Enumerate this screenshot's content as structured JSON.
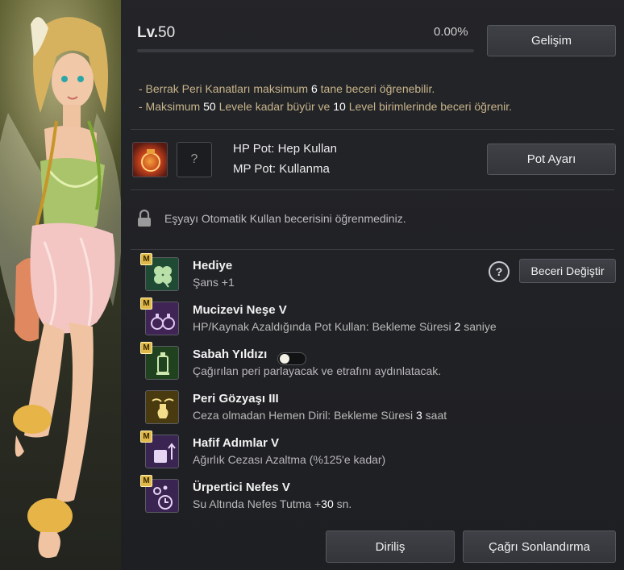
{
  "level": {
    "prefix": "Lv.",
    "value": "50",
    "percent": "0.00%",
    "progress": 0
  },
  "buttons": {
    "upgrade": "Gelişim",
    "pot_settings": "Pot Ayarı",
    "change_skill": "Beceri Değiştir",
    "revive": "Diriliş",
    "end_summon": "Çağrı Sonlandırma"
  },
  "info": {
    "line1_a": "- Berrak Peri Kanatları maksimum ",
    "line1_n": "6",
    "line1_b": " tane beceri öğrenebilir.",
    "line2_a": "- Maksimum ",
    "line2_n1": "50",
    "line2_b": " Levele kadar büyür ve ",
    "line2_n2": "10",
    "line2_c": " Level birimlerinde beceri öğrenir."
  },
  "pots": {
    "hp": "HP Pot: Hep Kullan",
    "mp": "MP Pot: Kullanma",
    "empty_slot": "?"
  },
  "auto_use": "Eşyayı Otomatik Kullan becerisini öğrenmediniz.",
  "help_symbol": "?",
  "skills": [
    {
      "badge": "M",
      "name": "Hediye",
      "desc": "Şans +1",
      "icon": "clover-icon",
      "color": "#2f6b45"
    },
    {
      "badge": "M",
      "name": "Mucizevi Neşe V",
      "desc_a": "HP/Kaynak Azaldığında Pot Kullan: Bekleme Süresi ",
      "desc_n": "2",
      "desc_b": " saniye",
      "icon": "potions-icon",
      "color": "#5a3470"
    },
    {
      "badge": "M",
      "name": "Sabah Yıldızı",
      "desc": "Çağırılan peri parlayacak ve etrafını aydınlatacak.",
      "icon": "lantern-icon",
      "color": "#2d5a2a",
      "toggle": false
    },
    {
      "badge": "",
      "name": "Peri Gözyaşı III",
      "desc_a": "Ceza olmadan Hemen Diril: Bekleme Süresi ",
      "desc_n": "3",
      "desc_b": " saat",
      "icon": "winged-vial-icon",
      "color": "#6a5418"
    },
    {
      "badge": "M",
      "name": "Hafif Adımlar V",
      "desc": "Ağırlık Cezası Azaltma (%125'e kadar)",
      "icon": "weight-icon",
      "color": "#4a2f66"
    },
    {
      "badge": "M",
      "name": "Ürpertici Nefes V",
      "desc_a": "Su Altında Nefes Tutma +",
      "desc_n": "30",
      "desc_b": " sn.",
      "icon": "bubbles-icon",
      "color": "#4a2f66"
    }
  ]
}
